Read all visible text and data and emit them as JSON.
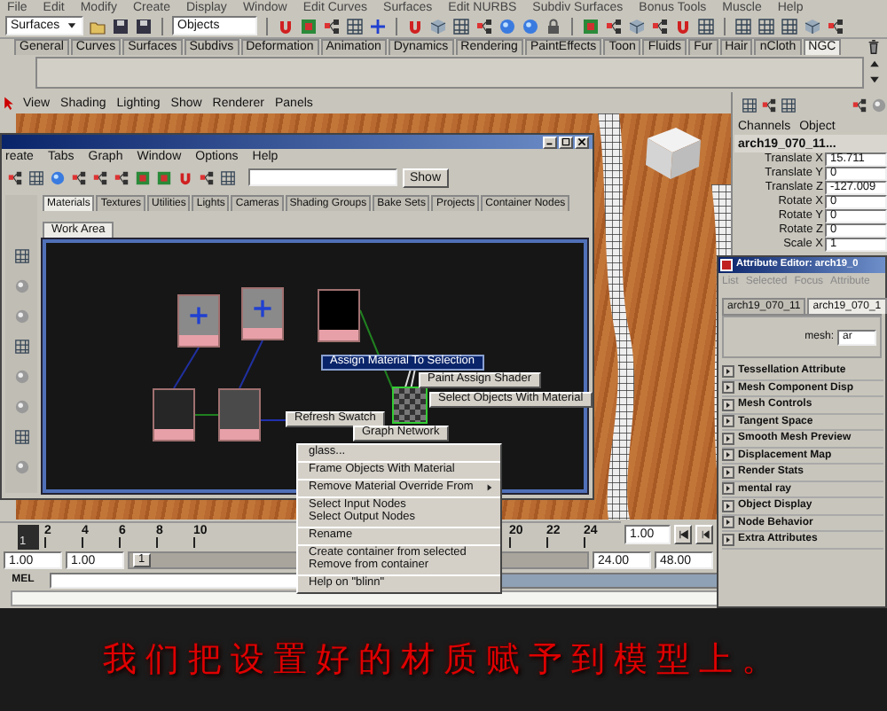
{
  "menubar": [
    "File",
    "Edit",
    "Modify",
    "Create",
    "Display",
    "Window",
    "Edit Curves",
    "Surfaces",
    "Edit NURBS",
    "Subdiv Surfaces",
    "Bonus Tools",
    "Muscle",
    "Help"
  ],
  "status_line": {
    "menu_set": "Surfaces",
    "selection_mode": "Objects"
  },
  "shelf_tabs": [
    {
      "label": "General",
      "selected": false
    },
    {
      "label": "Curves",
      "selected": false
    },
    {
      "label": "Surfaces",
      "selected": false
    },
    {
      "label": "Subdivs",
      "selected": false
    },
    {
      "label": "Deformation",
      "selected": false
    },
    {
      "label": "Animation",
      "selected": false
    },
    {
      "label": "Dynamics",
      "selected": false
    },
    {
      "label": "Rendering",
      "selected": false
    },
    {
      "label": "PaintEffects",
      "selected": false
    },
    {
      "label": "Toon",
      "selected": false
    },
    {
      "label": "Fluids",
      "selected": false
    },
    {
      "label": "Fur",
      "selected": false
    },
    {
      "label": "Hair",
      "selected": false
    },
    {
      "label": "nCloth",
      "selected": false
    },
    {
      "label": "NGC",
      "selected": true
    }
  ],
  "panel_menu": [
    "View",
    "Shading",
    "Lighting",
    "Show",
    "Renderer",
    "Panels"
  ],
  "hypershade": {
    "menus": [
      "reate",
      "Tabs",
      "Graph",
      "Window",
      "Options",
      "Help"
    ],
    "show_button": "Show",
    "tabs": [
      {
        "label": "Materials",
        "selected": true
      },
      {
        "label": "Textures",
        "selected": false
      },
      {
        "label": "Utilities",
        "selected": false
      },
      {
        "label": "Lights",
        "selected": false
      },
      {
        "label": "Cameras",
        "selected": false
      },
      {
        "label": "Shading Groups",
        "selected": false
      },
      {
        "label": "Bake Sets",
        "selected": false
      },
      {
        "label": "Projects",
        "selected": false
      },
      {
        "label": "Container Nodes",
        "selected": false
      }
    ],
    "work_tabs": [
      {
        "label": "Work Area",
        "selected": true
      }
    ],
    "marking_menu": [
      {
        "label": "Assign Material To Selection",
        "selected": true
      },
      {
        "label": "Paint Assign Shader",
        "selected": false
      },
      {
        "label": "Select Objects With Material",
        "selected": false
      },
      {
        "label": "Refresh Swatch",
        "selected": false
      },
      {
        "label": "Graph Network",
        "selected": false
      }
    ]
  },
  "context_menu": {
    "groups": [
      [
        {
          "label": "glass...",
          "submenu": false
        }
      ],
      [
        {
          "label": "Frame Objects With Material",
          "submenu": false
        }
      ],
      [
        {
          "label": "Remove Material Override From",
          "submenu": true
        }
      ],
      [
        {
          "label": "Select Input Nodes",
          "submenu": false
        },
        {
          "label": "Select Output Nodes",
          "submenu": false
        }
      ],
      [
        {
          "label": "Rename",
          "submenu": false
        }
      ],
      [
        {
          "label": "Create container from selected",
          "submenu": false
        },
        {
          "label": "Remove from container",
          "submenu": false
        }
      ],
      [
        {
          "label": "Help on \"blinn\"",
          "submenu": false
        }
      ]
    ]
  },
  "channel_box": {
    "menus": [
      "Channels",
      "Object"
    ],
    "object_name": "arch19_070_11...",
    "attributes": [
      {
        "name": "Translate X",
        "value": "15.711"
      },
      {
        "name": "Translate Y",
        "value": "0"
      },
      {
        "name": "Translate Z",
        "value": "-127.009"
      },
      {
        "name": "Rotate X",
        "value": "0"
      },
      {
        "name": "Rotate Y",
        "value": "0"
      },
      {
        "name": "Rotate Z",
        "value": "0"
      },
      {
        "name": "Scale X",
        "value": "1"
      }
    ]
  },
  "attribute_editor": {
    "title": "Attribute Editor: arch19_0",
    "menus": [
      "List",
      "Selected",
      "Focus",
      "Attribute"
    ],
    "tabs": [
      {
        "label": "arch19_070_11",
        "selected": false
      },
      {
        "label": "arch19_070_1",
        "selected": true
      }
    ],
    "node_type_label": "mesh:",
    "node_name": "ar",
    "sections": [
      "Tessellation Attribute",
      "Mesh Component Disp",
      "Mesh Controls",
      "Tangent Space",
      "Smooth Mesh Preview",
      "Displacement Map",
      "Render Stats",
      "mental ray",
      "Object Display",
      "Node Behavior",
      "Extra Attributes"
    ]
  },
  "timeline": {
    "current_frame": "1",
    "ticks_before_menu": [
      "2",
      "4",
      "6",
      "8",
      "10"
    ],
    "ticks_after_menu": [
      "20",
      "22",
      "24"
    ],
    "current_time": "1.00"
  },
  "range_slider": {
    "start_time": "1.00",
    "playback_start": "1.00",
    "handle_label": "1",
    "playback_end": "24.00",
    "end_time": "48.00"
  },
  "command_line": {
    "language": "MEL"
  },
  "subtitle": "我们把设置好的材质赋予到模型上。"
}
